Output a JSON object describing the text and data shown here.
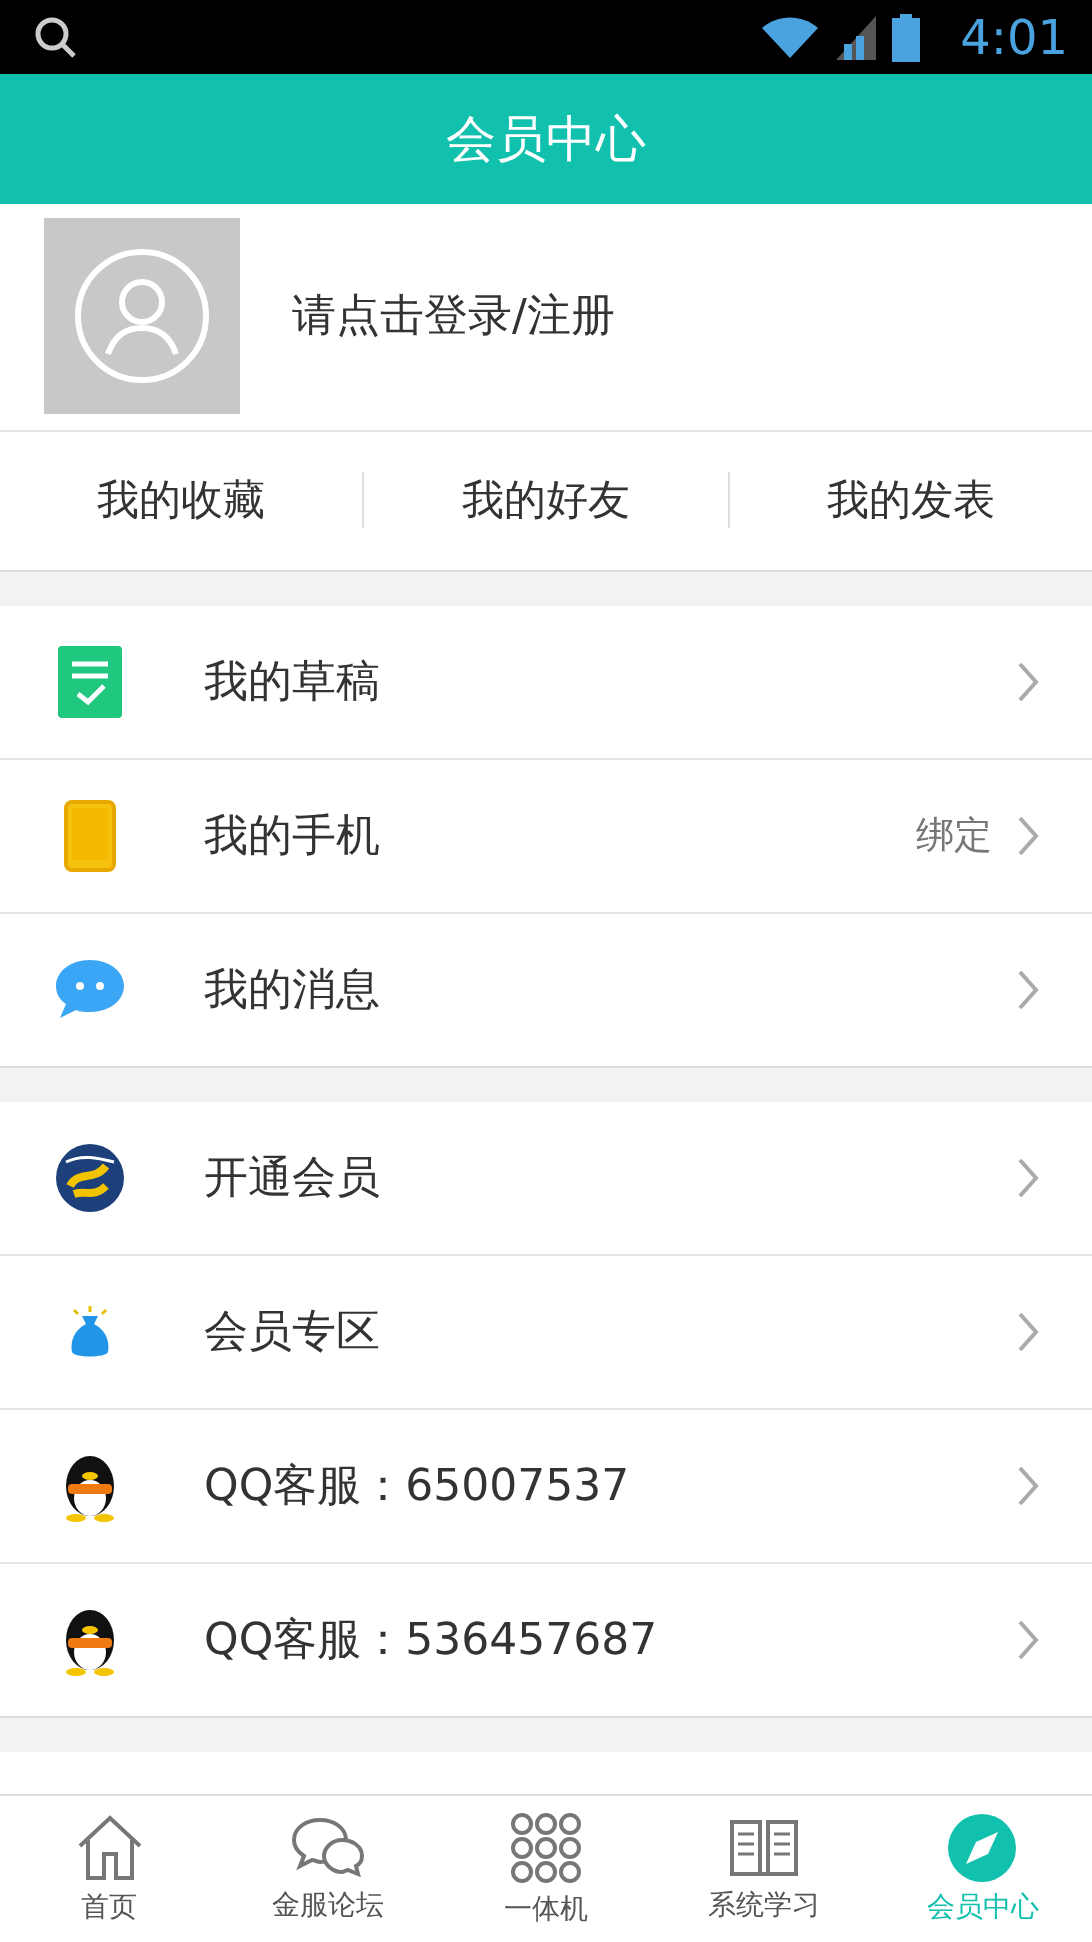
{
  "status_bar": {
    "time": "4:01"
  },
  "header": {
    "title": "会员中心"
  },
  "profile": {
    "login_prompt": "请点击登录/注册"
  },
  "quick_links": [
    "我的收藏",
    "我的好友",
    "我的发表"
  ],
  "groups": [
    [
      {
        "kind": "draft",
        "label": "我的草稿"
      },
      {
        "kind": "phone",
        "label": "我的手机",
        "detail": "绑定"
      },
      {
        "kind": "message",
        "label": "我的消息"
      }
    ],
    [
      {
        "kind": "dragon",
        "label": "开通会员"
      },
      {
        "kind": "bag",
        "label": "会员专区"
      },
      {
        "kind": "penguin",
        "label": "QQ客服：65007537"
      },
      {
        "kind": "penguin",
        "label": "QQ客服：536457687"
      }
    ]
  ],
  "tabs": [
    {
      "kind": "home",
      "label": "首页",
      "selected": false
    },
    {
      "kind": "chat",
      "label": "金服论坛",
      "selected": false
    },
    {
      "kind": "grid",
      "label": "一体机",
      "selected": false
    },
    {
      "kind": "book",
      "label": "系统学习",
      "selected": false
    },
    {
      "kind": "compass",
      "label": "会员中心",
      "selected": true
    }
  ]
}
